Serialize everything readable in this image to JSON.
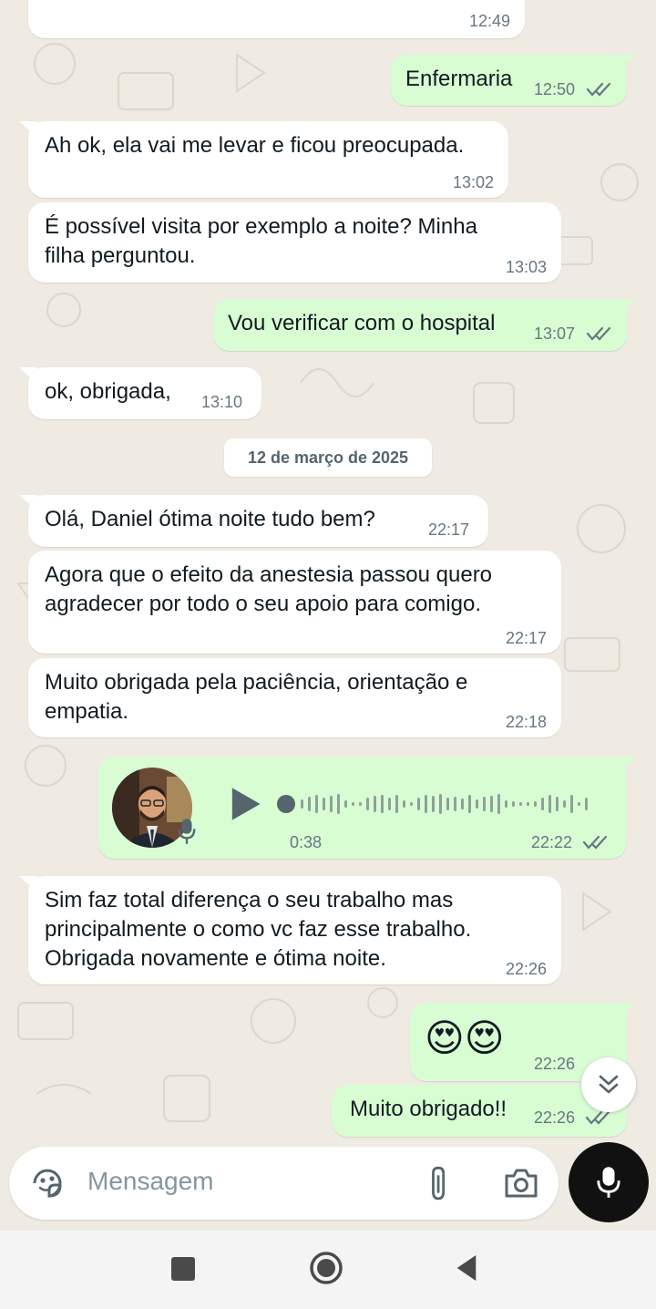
{
  "messages": [
    {
      "dir": "in",
      "text": "",
      "time": "12:49"
    },
    {
      "dir": "out",
      "text": "Enfermaria",
      "time": "12:50",
      "status": "read"
    },
    {
      "dir": "in",
      "text": "Ah ok, ela vai me levar e ficou preocupada.",
      "time": "13:02"
    },
    {
      "dir": "in",
      "text": "É possível visita por exemplo a noite?  Minha\nfilha perguntou.",
      "time": "13:03"
    },
    {
      "dir": "out",
      "text": "Vou verificar com o hospital",
      "time": "13:07",
      "status": "read"
    },
    {
      "dir": "in",
      "text": "ok, obrigada,",
      "time": "13:10"
    },
    {
      "dir": "in",
      "text": "Olá,  Daniel ótima noite tudo bem?",
      "time": "22:17"
    },
    {
      "dir": "in",
      "text": "Agora que o efeito da anestesia passou quero\nagradecer por todo o seu apoio para comigo.",
      "time": "22:17"
    },
    {
      "dir": "in",
      "text": "Muito obrigada pela paciência, orientação e\nempatia.",
      "time": "22:18"
    },
    {
      "dir": "in",
      "text": "Sim faz total diferença o seu trabalho mas\nprincipalmente o como vc faz esse trabalho.\nObrigada novamente e ótima noite.",
      "time": "22:26"
    },
    {
      "dir": "out",
      "text": "😍😍",
      "time": "22:26",
      "status": "read"
    },
    {
      "dir": "out",
      "text": "Muito obrigado!!",
      "time": "22:26",
      "status": "read"
    }
  ],
  "date_separator": "12 de março de 2025",
  "voice_note": {
    "duration": "0:38",
    "time": "22:22",
    "status": "read",
    "progress": 0
  },
  "composer": {
    "placeholder": "Mensagem"
  },
  "icons": {
    "sticker": "sticker-icon",
    "attach": "paperclip-icon",
    "camera": "camera-icon",
    "mic": "mic-icon",
    "scroll": "double-chevron-down-icon",
    "play": "play-icon",
    "read_status": "double-check-icon",
    "nav_recents": "square-icon",
    "nav_home": "circle-icon",
    "nav_back": "triangle-back-icon"
  },
  "colors": {
    "chat_bg": "#efeae2",
    "incoming": "#ffffff",
    "outgoing": "#d9fdd3",
    "timestamp": "#667781",
    "tick": "#667781"
  }
}
